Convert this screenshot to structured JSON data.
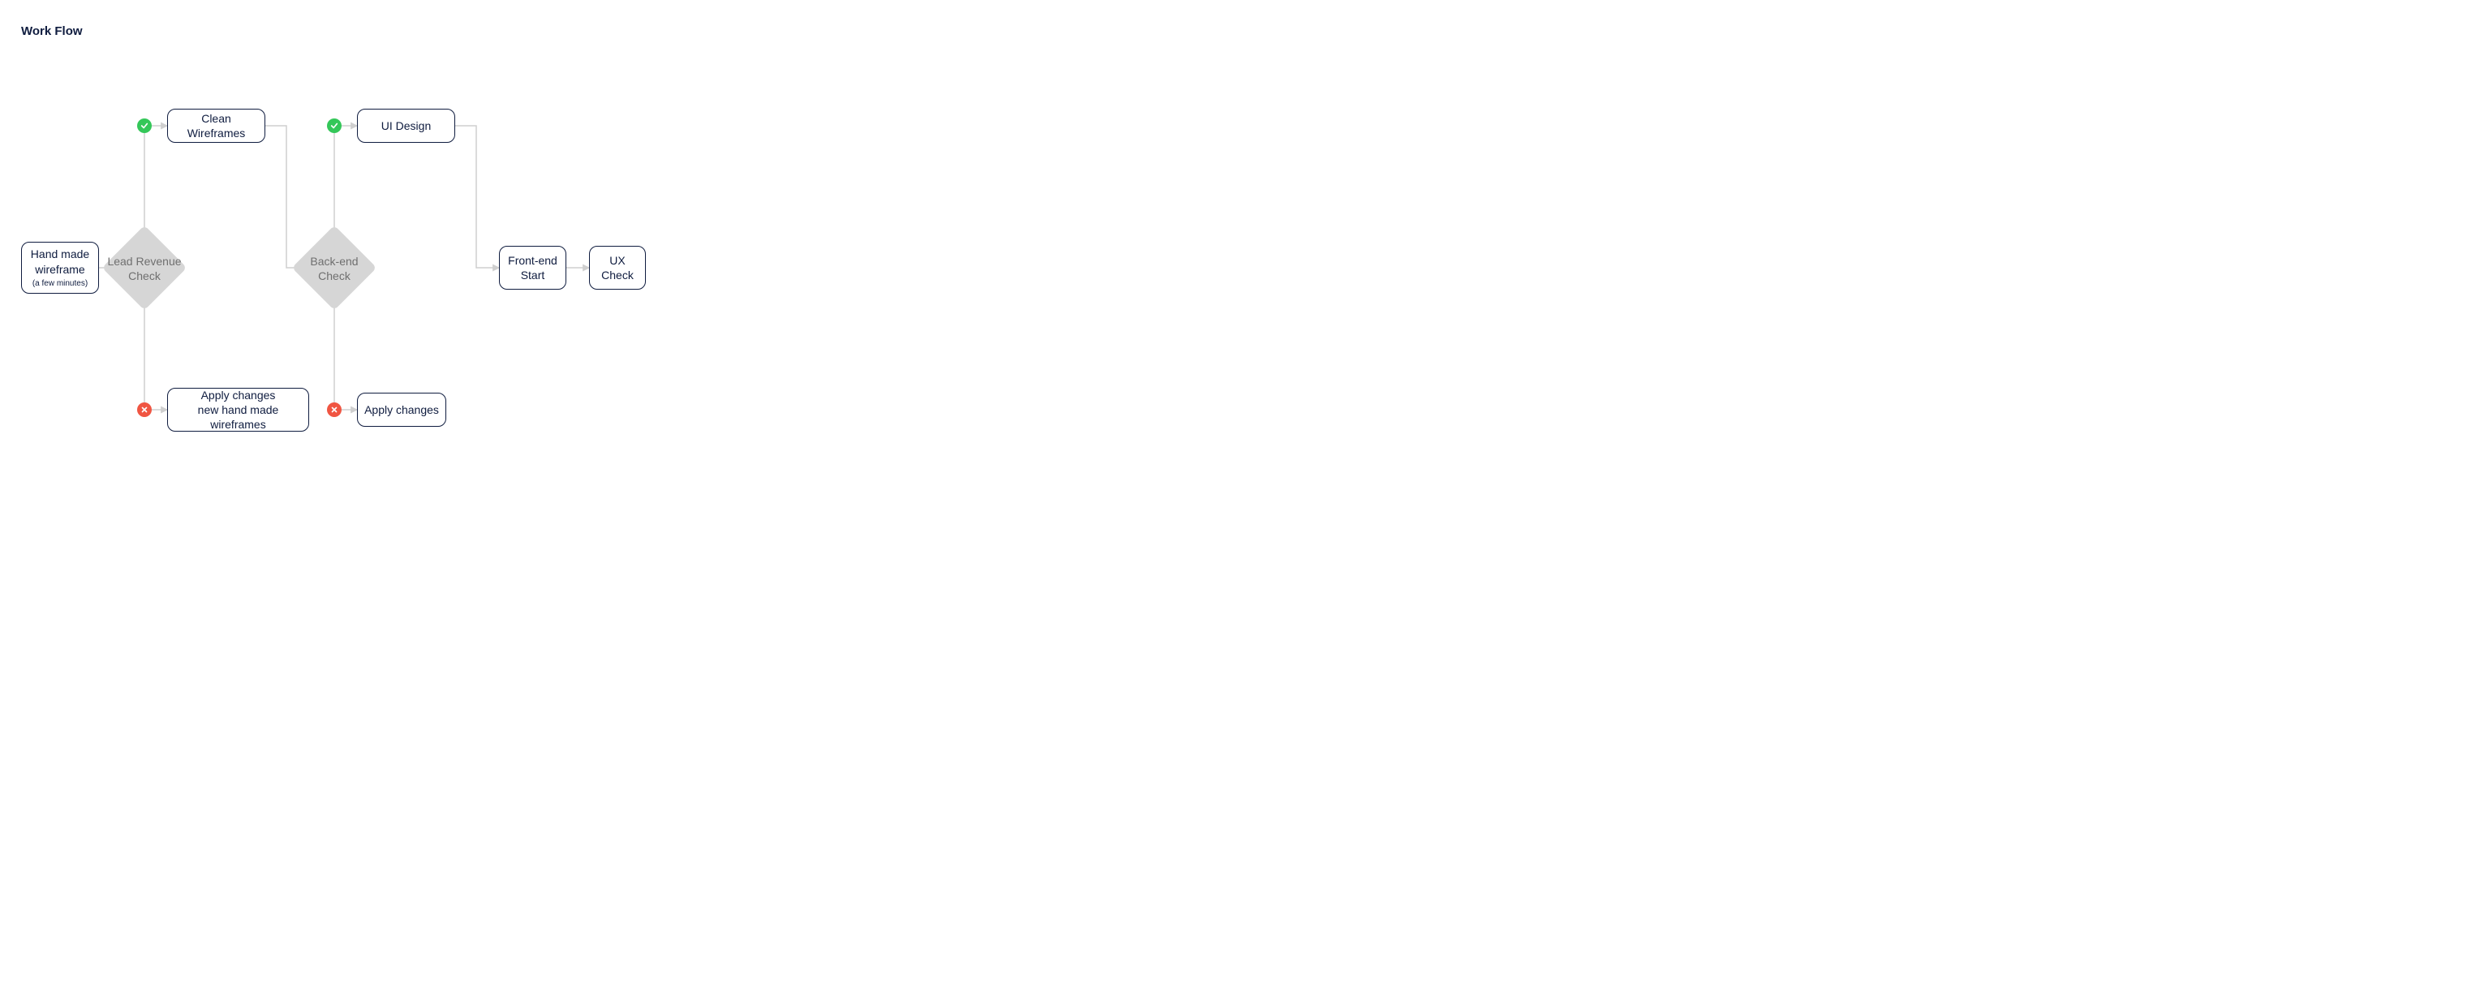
{
  "title": "Work Flow",
  "nodes": {
    "handmade": {
      "line1": "Hand made",
      "line2": "wireframe",
      "sub": "(a few minutes)"
    },
    "leadRevenue": {
      "line1": "Lead Revenue",
      "line2": "Check"
    },
    "cleanWireframes": {
      "line1": "Clean Wireframes"
    },
    "applyChanges1": {
      "line1": "Apply changes",
      "line2": "new hand made wireframes"
    },
    "backendCheck": {
      "line1": "Back-end",
      "line2": "Check"
    },
    "uiDesign": {
      "line1": "UI Design"
    },
    "applyChanges2": {
      "line1": "Apply changes"
    },
    "frontendStart": {
      "line1": "Front-end",
      "line2": "Start"
    },
    "uxCheck": {
      "line1": "UX",
      "line2": "Check"
    }
  },
  "badges": {
    "pass": "check-icon",
    "fail": "cross-icon"
  },
  "colors": {
    "navy": "#0f1c3f",
    "greyFill": "#d6d6d6",
    "greyLine": "#cfcfcf",
    "greyText": "#6f6f6f",
    "green": "#34c759",
    "red": "#f05542"
  },
  "chart_data": {
    "type": "flowchart",
    "title": "Work Flow",
    "nodes": [
      {
        "id": "handmade",
        "type": "process",
        "label": "Hand made wireframe",
        "sublabel": "(a few minutes)"
      },
      {
        "id": "leadRevenue",
        "type": "decision",
        "label": "Lead Revenue Check"
      },
      {
        "id": "cleanWireframes",
        "type": "process",
        "label": "Clean Wireframes"
      },
      {
        "id": "applyChanges1",
        "type": "process",
        "label": "Apply changes new hand made wireframes"
      },
      {
        "id": "backendCheck",
        "type": "decision",
        "label": "Back-end Check"
      },
      {
        "id": "uiDesign",
        "type": "process",
        "label": "UI Design"
      },
      {
        "id": "applyChanges2",
        "type": "process",
        "label": "Apply changes"
      },
      {
        "id": "frontendStart",
        "type": "process",
        "label": "Front-end Start"
      },
      {
        "id": "uxCheck",
        "type": "process",
        "label": "UX Check"
      }
    ],
    "edges": [
      {
        "from": "handmade",
        "to": "leadRevenue"
      },
      {
        "from": "leadRevenue",
        "to": "cleanWireframes",
        "result": "pass"
      },
      {
        "from": "leadRevenue",
        "to": "applyChanges1",
        "result": "fail"
      },
      {
        "from": "applyChanges1",
        "to": "leadRevenue"
      },
      {
        "from": "cleanWireframes",
        "to": "backendCheck"
      },
      {
        "from": "backendCheck",
        "to": "uiDesign",
        "result": "pass"
      },
      {
        "from": "backendCheck",
        "to": "applyChanges2",
        "result": "fail"
      },
      {
        "from": "applyChanges2",
        "to": "backendCheck"
      },
      {
        "from": "uiDesign",
        "to": "frontendStart"
      },
      {
        "from": "frontendStart",
        "to": "uxCheck"
      }
    ]
  }
}
